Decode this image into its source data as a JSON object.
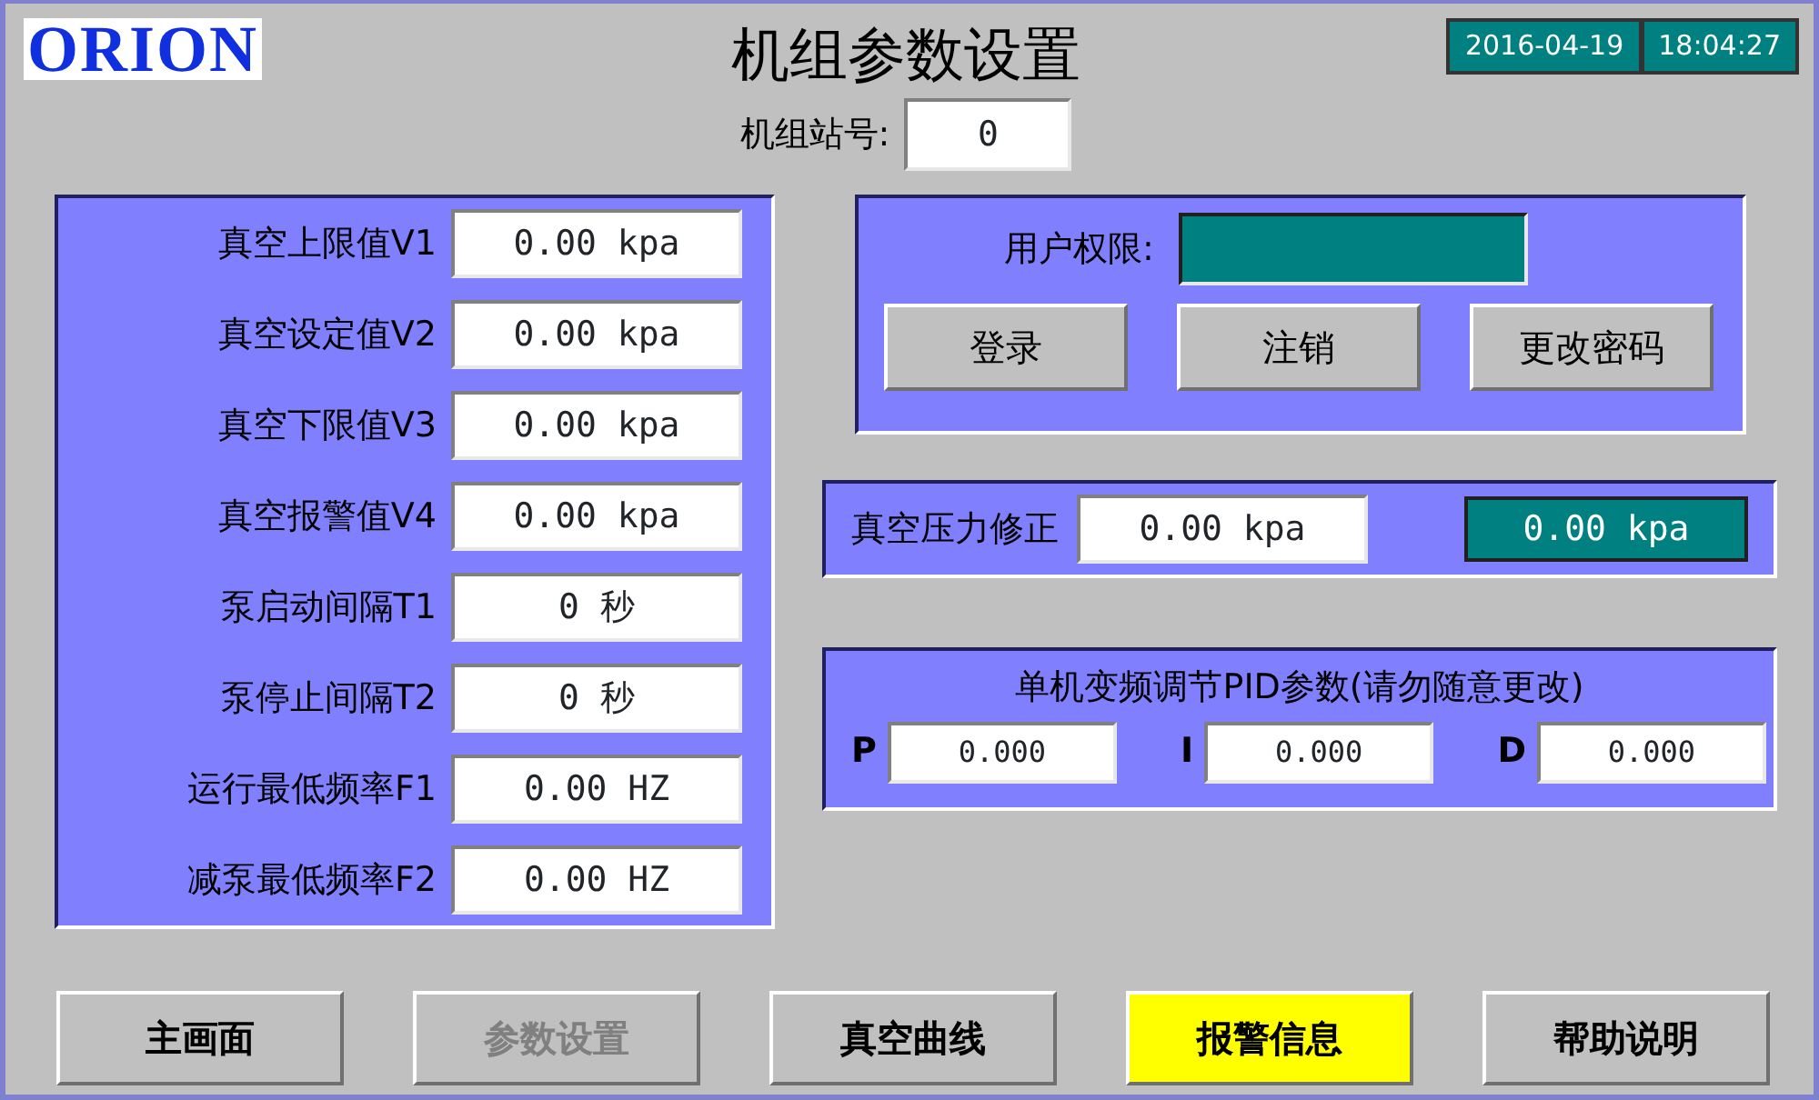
{
  "logo": "ORION",
  "title": "机组参数设置",
  "date": "2016-04-19",
  "time": "18:04:27",
  "station": {
    "label": "机组站号:",
    "value": "0"
  },
  "parameters": [
    {
      "label": "真空上限值V1",
      "value": "0.00 kpa"
    },
    {
      "label": "真空设定值V2",
      "value": "0.00 kpa"
    },
    {
      "label": "真空下限值V3",
      "value": "0.00 kpa"
    },
    {
      "label": "真空报警值V4",
      "value": "0.00 kpa"
    },
    {
      "label": "泵启动间隔T1",
      "value": "0 秒"
    },
    {
      "label": "泵停止间隔T2",
      "value": "0 秒"
    },
    {
      "label": "运行最低频率F1",
      "value": "0.00 HZ"
    },
    {
      "label": "减泵最低频率F2",
      "value": "0.00 HZ"
    }
  ],
  "user": {
    "label": "用户权限:",
    "buttons": [
      "登录",
      "注销",
      "更改密码"
    ]
  },
  "correction": {
    "label": "真空压力修正",
    "input": "0.00 kpa",
    "reading": "0.00 kpa"
  },
  "pid": {
    "title": "单机变频调节PID参数(请勿随意更改)",
    "fields": [
      {
        "label": "P",
        "value": "0.000"
      },
      {
        "label": "I",
        "value": "0.000"
      },
      {
        "label": "D",
        "value": "0.000"
      }
    ]
  },
  "nav": [
    {
      "label": "主画面",
      "disabled": false,
      "highlighted": false
    },
    {
      "label": "参数设置",
      "disabled": true,
      "highlighted": false
    },
    {
      "label": "真空曲线",
      "disabled": false,
      "highlighted": false
    },
    {
      "label": "报警信息",
      "disabled": false,
      "highlighted": true
    },
    {
      "label": "帮助说明",
      "disabled": false,
      "highlighted": false
    }
  ]
}
